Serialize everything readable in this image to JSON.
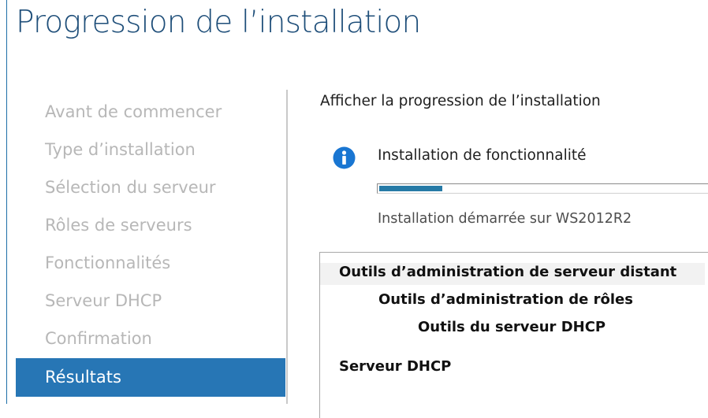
{
  "window": {
    "title": "Progression de l’installation"
  },
  "nav": {
    "items": [
      {
        "label": "Avant de commencer",
        "active": false
      },
      {
        "label": "Type d’installation",
        "active": false
      },
      {
        "label": "Sélection du serveur",
        "active": false
      },
      {
        "label": "Rôles de serveurs",
        "active": false
      },
      {
        "label": "Fonctionnalités",
        "active": false
      },
      {
        "label": "Serveur DHCP",
        "active": false
      },
      {
        "label": "Confirmation",
        "active": false
      },
      {
        "label": "Résultats",
        "active": true
      }
    ]
  },
  "main": {
    "heading": "Afficher la progression de l’installation",
    "status": {
      "icon": "info-icon",
      "title": "Installation de fonctionnalité",
      "progress_percent": 20,
      "subtitle": "Installation démarrée sur WS2012R2"
    },
    "results": [
      "Outils d’administration de serveur distant",
      "Outils d’administration de rôles",
      "Outils du serveur DHCP",
      "Serveur DHCP"
    ]
  },
  "colors": {
    "accent": "#2776b5",
    "title": "#1e4e79",
    "progress": "#267aa6",
    "nav_inactive": "#b7b7b7"
  }
}
